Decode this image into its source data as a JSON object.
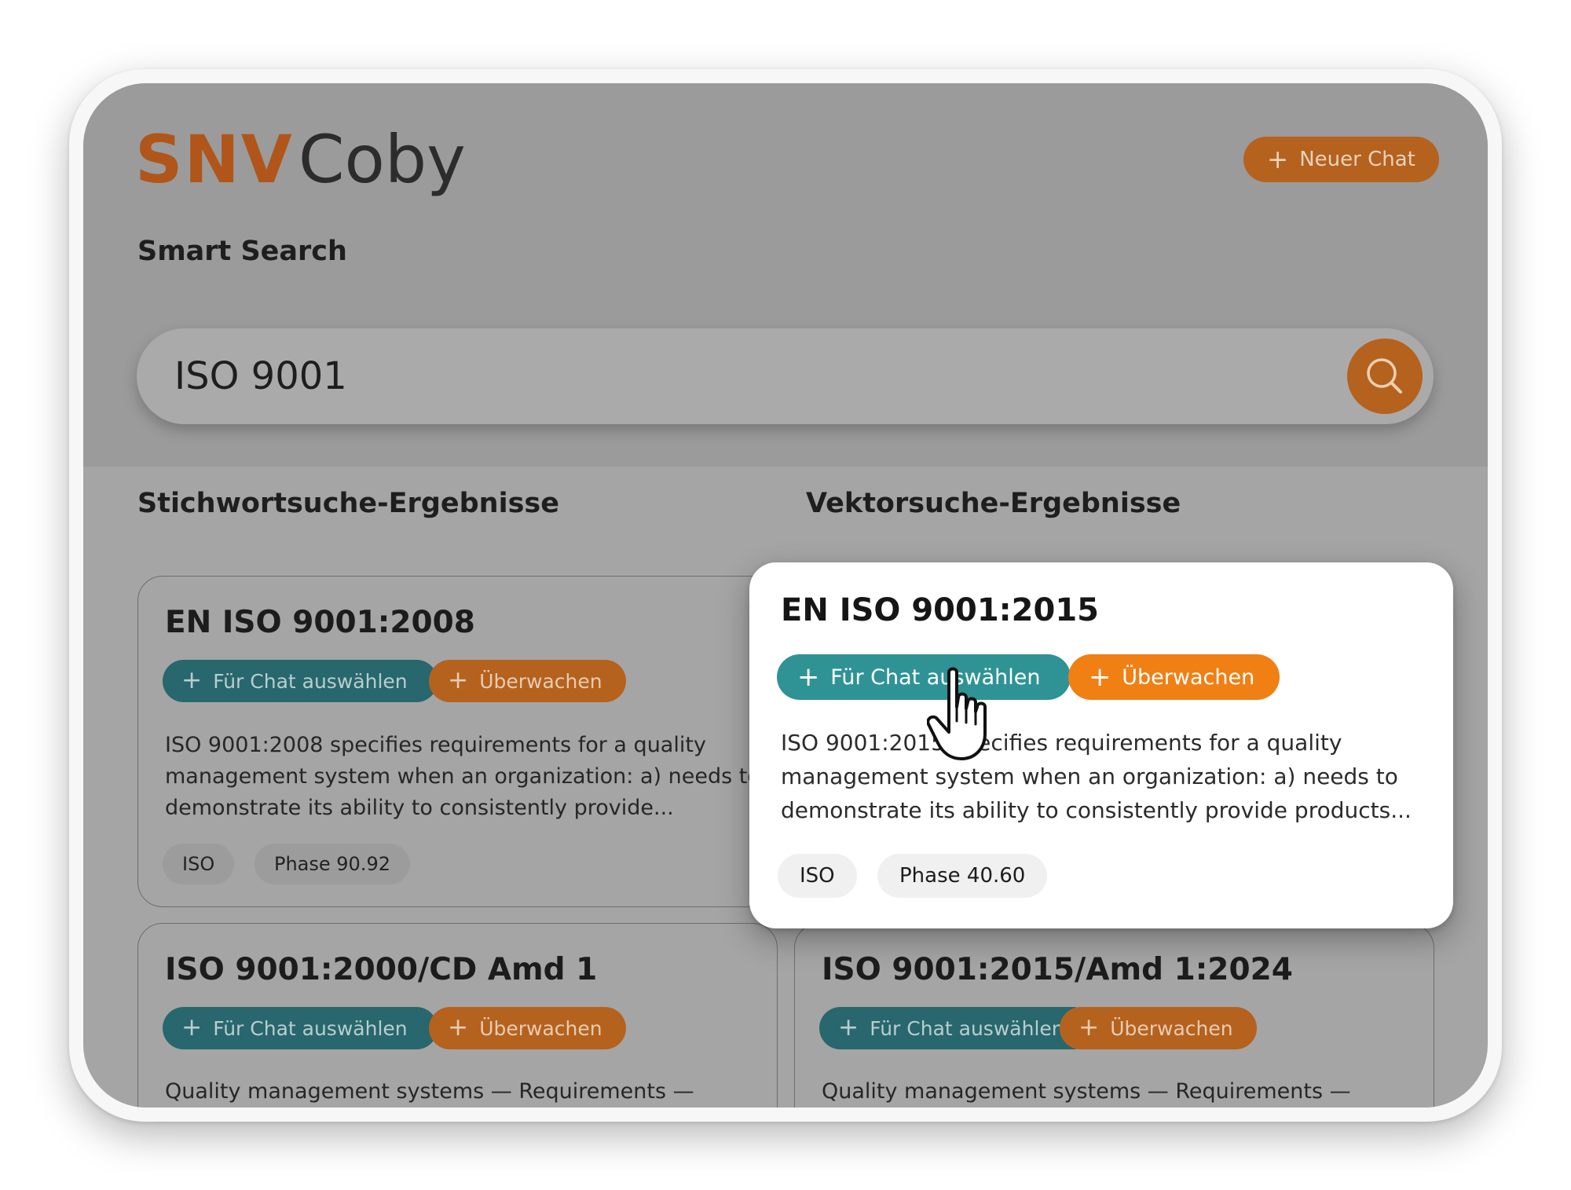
{
  "app": {
    "logo_brand": "SNV",
    "logo_product": "Coby"
  },
  "header": {
    "new_chat_label": "Neuer Chat"
  },
  "search": {
    "section_title": "Smart Search",
    "query": "ISO 9001"
  },
  "keyword_results": {
    "title": "Stichwortsuche-Ergebnisse",
    "cards": [
      {
        "title": "EN ISO 9001:2008",
        "select_label": "Für Chat auswählen",
        "watch_label": "Überwachen",
        "description": "ISO 9001:2008 specifies requirements for a quality management system when an organization:  a) needs to demonstrate its ability to consistently provide...",
        "tags": [
          "ISO",
          "Phase 90.92"
        ]
      },
      {
        "title": "ISO 9001:2000/CD Amd 1",
        "select_label": "Für Chat auswählen",
        "watch_label": "Überwachen",
        "description": "Quality management systems — Requirements —"
      }
    ]
  },
  "vector_results": {
    "title": "Vektorsuche-Ergebnisse",
    "cards": [
      {
        "title": "EN ISO 9001:2015",
        "select_label": "Für Chat auswählen",
        "watch_label": "Überwachen",
        "description": "ISO 9001:2015 specifies requirements for a quality management system when an organization: a) needs to demonstrate its ability to consistently provide products...",
        "tags": [
          "ISO",
          "Phase 40.60"
        ]
      },
      {
        "title": "ISO 9001:2015/Amd 1:2024",
        "select_label": "Für Chat auswählen",
        "watch_label": "Überwachen",
        "description": "Quality management systems — Requirements —"
      }
    ]
  },
  "colors": {
    "brand_orange": "#b5621e",
    "active_orange": "#f07f14",
    "teal": "#27676d",
    "active_teal": "#2f9396",
    "overlay_gray": "#a5a5a5"
  },
  "icons": [
    "plus-icon",
    "search-icon",
    "hand-pointer-cursor-icon"
  ]
}
